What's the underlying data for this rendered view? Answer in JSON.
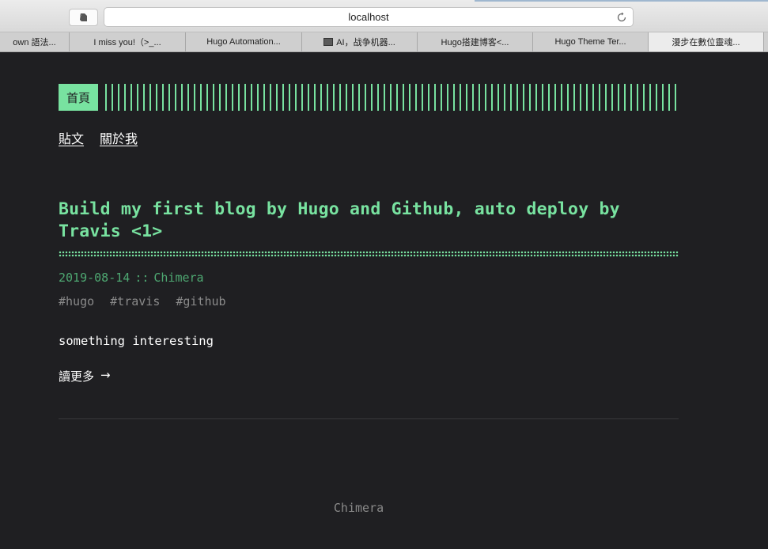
{
  "browser": {
    "url": "localhost",
    "tabs": [
      {
        "label": "own 語法..."
      },
      {
        "label": "I miss you!（>_..."
      },
      {
        "label": "Hugo Automation..."
      },
      {
        "label": "AI，战争机器..."
      },
      {
        "label": "Hugo搭建博客<..."
      },
      {
        "label": "Hugo Theme Ter..."
      },
      {
        "label": "漫步在數位靈魂..."
      }
    ]
  },
  "site": {
    "logo": "首頁",
    "menu": [
      "貼文",
      "關於我"
    ]
  },
  "post": {
    "title": "Build my first blog by Hugo and Github, auto deploy by Travis <1>",
    "date": "2019-08-14",
    "separator": "::",
    "author": "Chimera",
    "tags": [
      "#hugo",
      "#travis",
      "#github"
    ],
    "summary": "something interesting",
    "read_more": "讀更多",
    "read_more_arrow": "→"
  },
  "footer": {
    "text": "Chimera"
  },
  "colors": {
    "accent": "#78e2a0",
    "background": "#1f1f22",
    "muted": "#8a8a8a"
  }
}
